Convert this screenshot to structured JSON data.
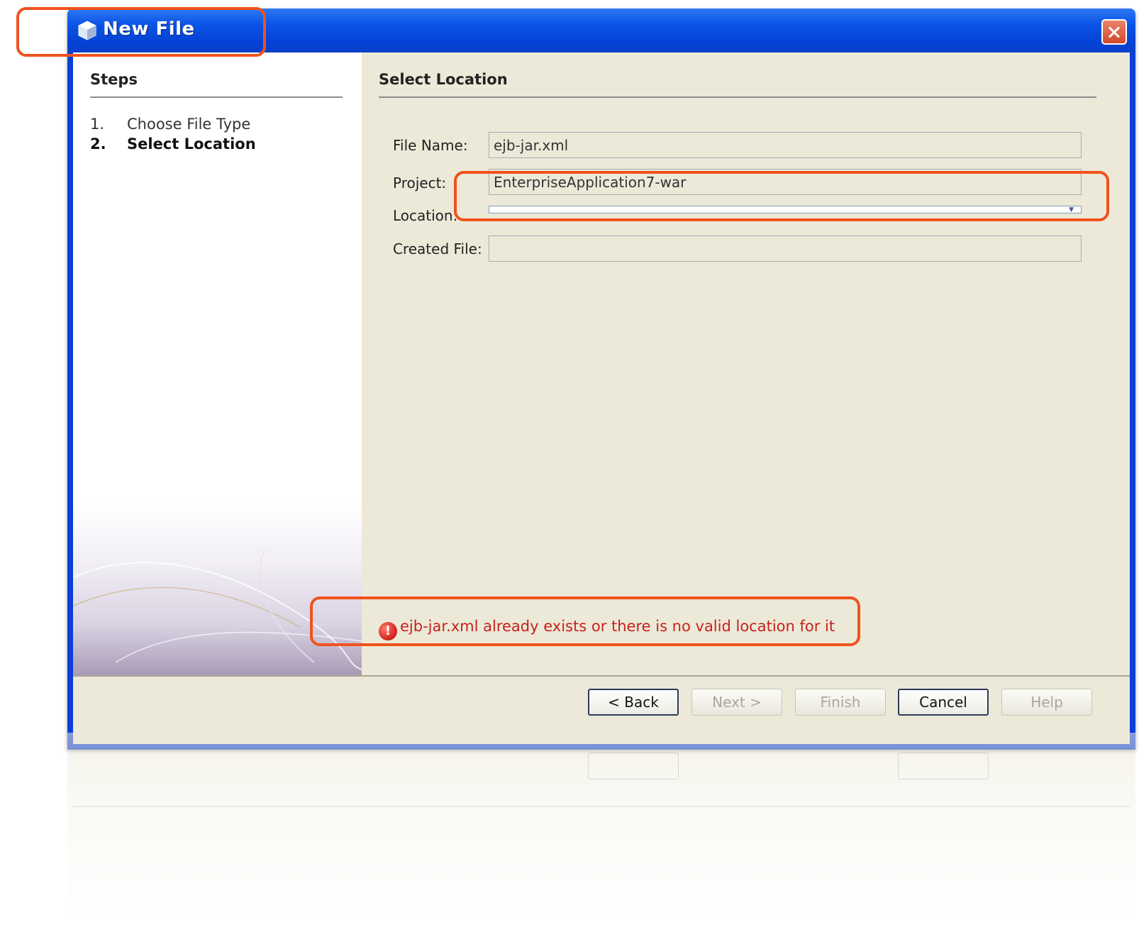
{
  "window": {
    "title": "New File"
  },
  "steps": {
    "heading": "Steps",
    "items": [
      {
        "num": "1.",
        "label": "Choose File Type",
        "active": false
      },
      {
        "num": "2.",
        "label": "Select Location",
        "active": true
      }
    ]
  },
  "panel": {
    "heading": "Select Location",
    "fields": {
      "file_name_label": "File Name:",
      "file_name_value": "ejb-jar.xml",
      "project_label": "Project:",
      "project_value": "EnterpriseApplication7-war",
      "location_label": "Location:",
      "location_value": "",
      "created_file_label": "Created File:",
      "created_file_value": ""
    }
  },
  "error": {
    "icon": "error-icon",
    "message": "ejb-jar.xml already exists or there is no valid location for it",
    "color": "#c8211e"
  },
  "buttons": {
    "back": "< Back",
    "next": "Next >",
    "finish": "Finish",
    "cancel": "Cancel",
    "help": "Help"
  },
  "colors": {
    "titlebar": "#0b55e6",
    "highlight": "#f0521d",
    "dialog_bg": "#ece9d8"
  }
}
